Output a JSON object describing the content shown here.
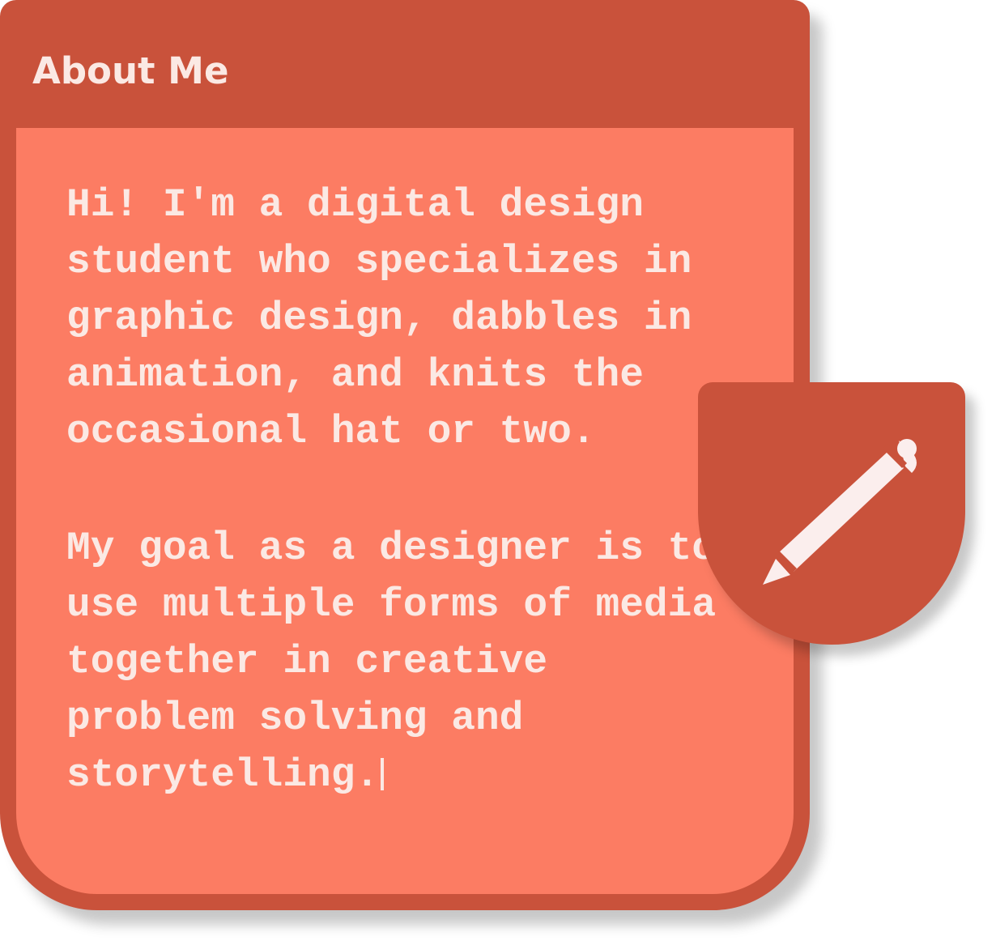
{
  "card": {
    "title": "About Me",
    "bio_paragraphs": [
      "Hi! I'm a digital design student who specializes in graphic design, dabbles in animation, and knits the occasional hat or two.",
      "My goal as a designer is to use multiple forms of media together in creative problem solving and storytelling."
    ]
  },
  "edit_button": {
    "icon": "pencil-icon"
  },
  "colors": {
    "card_frame": "#c9523b",
    "card_body": "#fc7c63",
    "text": "#fbe9e4"
  }
}
